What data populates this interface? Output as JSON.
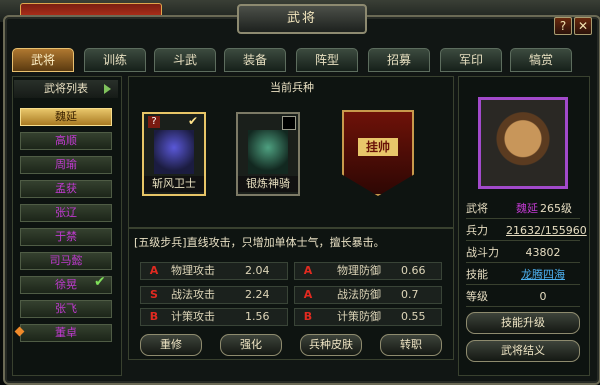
{
  "window": {
    "title": "武将",
    "help_glyph": "?",
    "close_glyph": "✕"
  },
  "tabs": [
    {
      "label": "武将",
      "active": true
    },
    {
      "label": "训练"
    },
    {
      "label": "斗武"
    },
    {
      "label": "装备"
    },
    {
      "label": "阵型"
    },
    {
      "label": "招募"
    },
    {
      "label": "军印"
    },
    {
      "label": "犒赏"
    }
  ],
  "general_list": {
    "header": "武将列表",
    "items": [
      "魏延",
      "高顺",
      "周瑜",
      "孟获",
      "张辽",
      "于禁",
      "司马懿",
      "徐晃",
      "张飞",
      "董卓"
    ],
    "selected_index": 0,
    "checked_index": 7
  },
  "troops": {
    "title": "当前兵种",
    "cards": [
      {
        "label": "斩风卫士",
        "badge": "?",
        "selected": true
      },
      {
        "label": "银炼神骑"
      }
    ],
    "emblem_text": "挂帅",
    "description": "[五级步兵]直线攻击，只增加单体士气，擅长暴击。",
    "stats": [
      {
        "grade": "A",
        "name": "物理攻击",
        "value": "2.04"
      },
      {
        "grade": "S",
        "name": "战法攻击",
        "value": "2.24"
      },
      {
        "grade": "B",
        "name": "计策攻击",
        "value": "1.56"
      },
      {
        "grade": "A",
        "name": "物理防御",
        "value": "0.66"
      },
      {
        "grade": "A",
        "name": "战法防御",
        "value": "0.7"
      },
      {
        "grade": "B",
        "name": "计策防御",
        "value": "0.55"
      }
    ],
    "buttons": [
      "重修",
      "强化",
      "兵种皮肤",
      "转职"
    ]
  },
  "general_info": {
    "rows": [
      {
        "label": "武将",
        "value": "魏延",
        "extra": "265级"
      },
      {
        "label": "兵力",
        "value": "21632/155960"
      },
      {
        "label": "战斗力",
        "value": "43802"
      },
      {
        "label": "技能",
        "value": "龙腾四海"
      },
      {
        "label": "等级",
        "value": "0"
      }
    ],
    "buttons": [
      "技能升级",
      "武将结义"
    ]
  },
  "colors": {
    "purple_name": "#c03ad0",
    "gold": "#e8c66a",
    "grade_red": "#e12a20",
    "skill_blue": "#4db0f0"
  }
}
